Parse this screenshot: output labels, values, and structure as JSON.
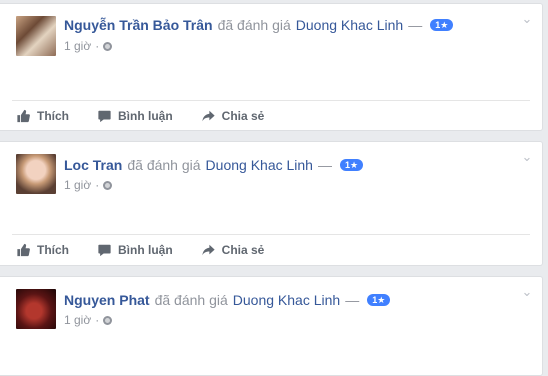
{
  "feed": {
    "posts": [
      {
        "author": "Nguyễn Trần Bảo Trân",
        "verb": "đã đánh giá",
        "page": "Duong Khac Linh",
        "dash": "—",
        "rating_badge": "1★",
        "time": "1 giờ",
        "dot": "·"
      },
      {
        "author": "Loc Tran",
        "verb": "đã đánh giá",
        "page": "Duong Khac Linh",
        "dash": "—",
        "rating_badge": "1★",
        "time": "1 giờ",
        "dot": "·"
      },
      {
        "author": "Nguyen Phat",
        "verb": "đã đánh giá",
        "page": "Duong Khac Linh",
        "dash": "—",
        "rating_badge": "1★",
        "time": "1 giờ",
        "dot": "·"
      }
    ],
    "actions": {
      "like": "Thích",
      "comment": "Bình luận",
      "share": "Chia sẻ"
    }
  },
  "icons": {
    "like": "thumbs-up-icon",
    "comment": "comment-icon",
    "share": "share-arrow-icon",
    "privacy": "globe-icon",
    "menu": "chevron-down-icon"
  },
  "colors": {
    "link": "#365899",
    "badge": "#4080ff",
    "muted": "#90949c",
    "background": "#e9ebee"
  }
}
